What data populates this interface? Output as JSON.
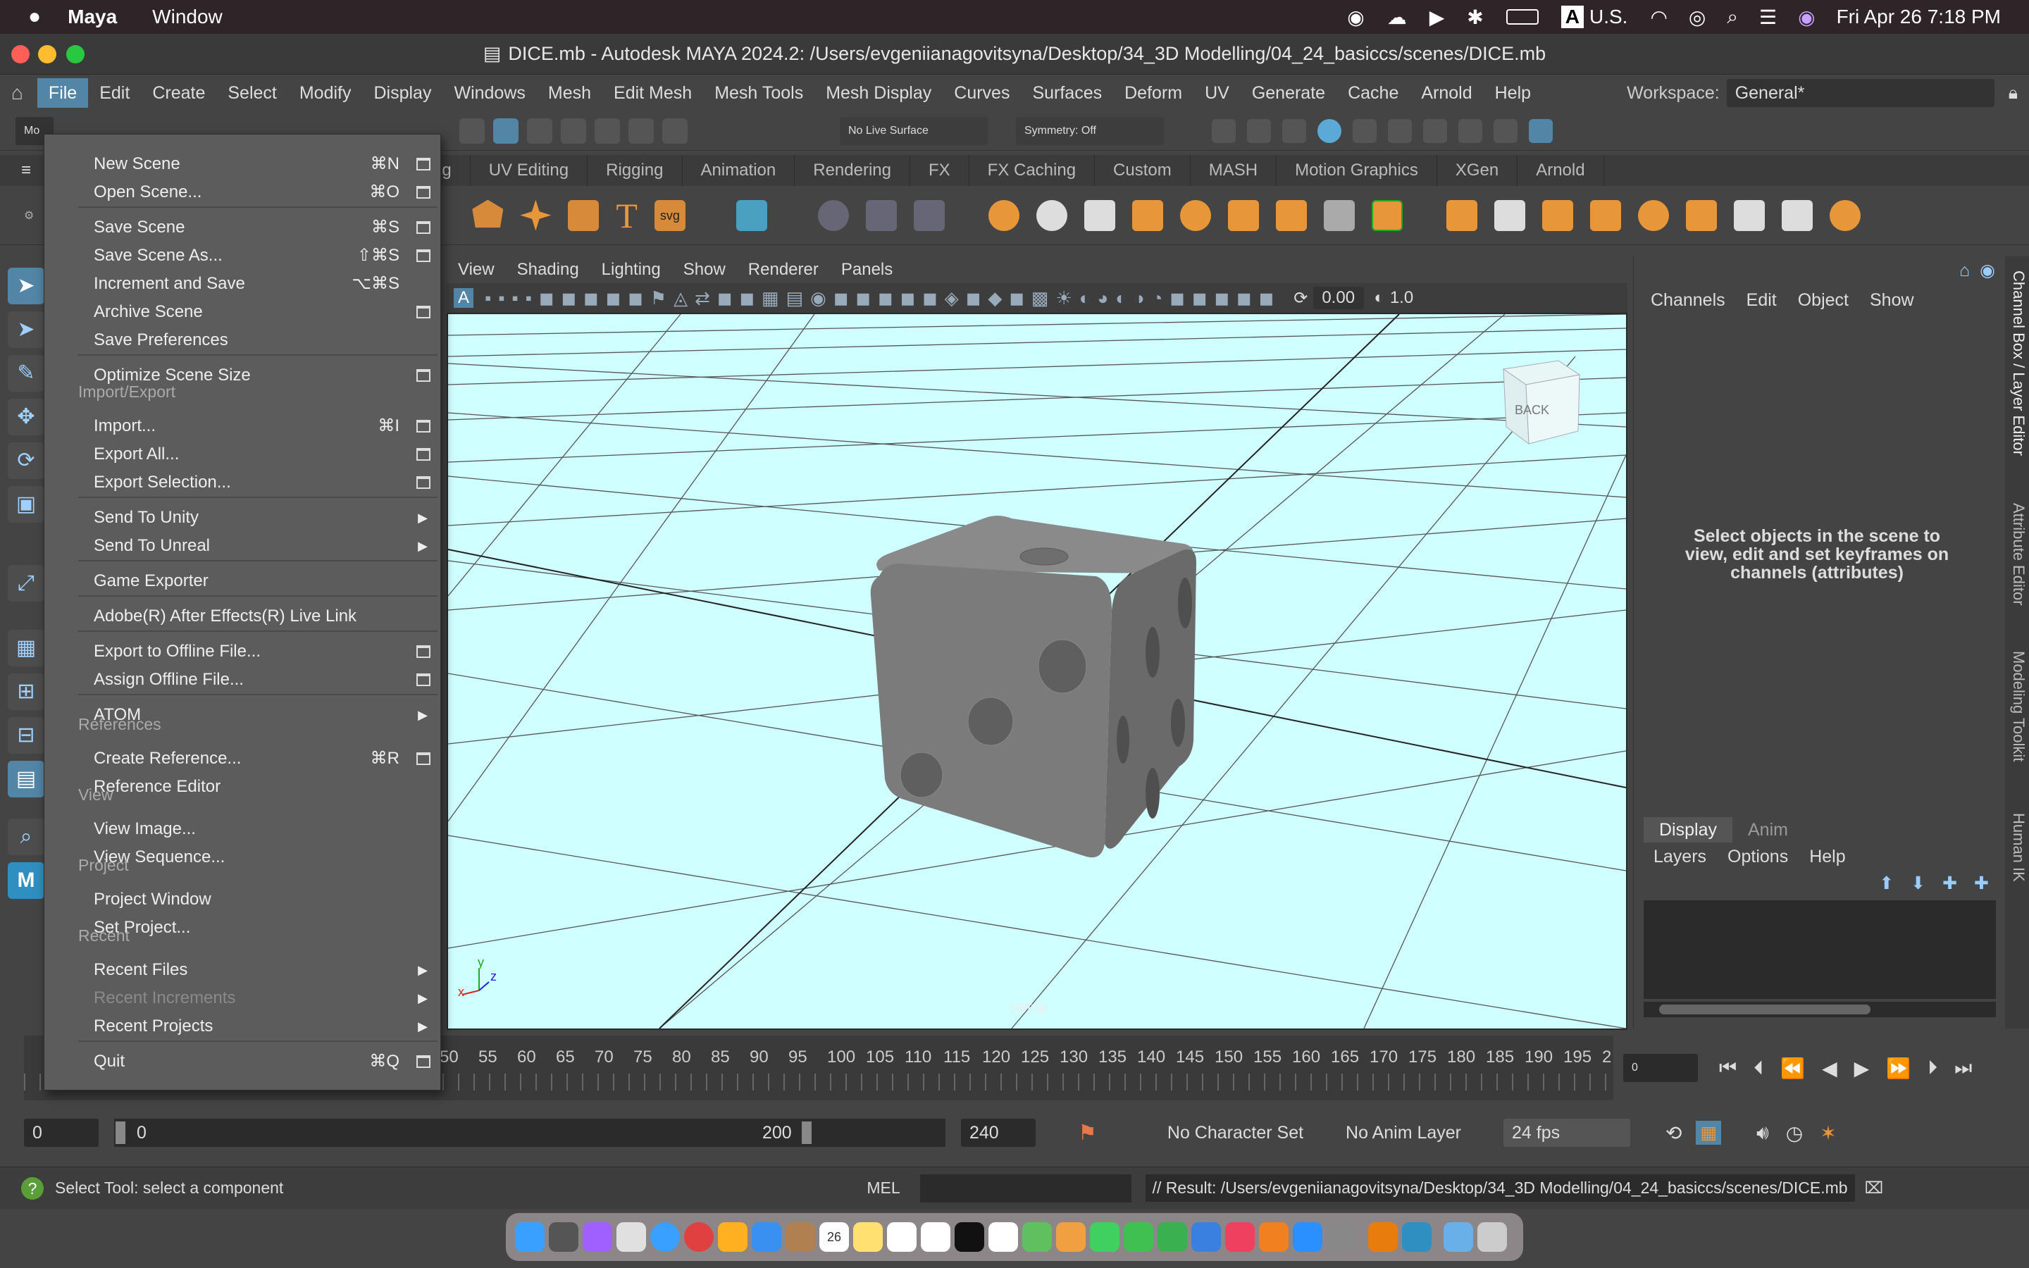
{
  "mac_menubar": {
    "app": "Maya",
    "items": [
      "Window"
    ],
    "input": "U.S.",
    "clock": "Fri Apr 26  7:18 PM"
  },
  "window": {
    "title": "DICE.mb - Autodesk MAYA 2024.2: /Users/evgeniianagovitsyna/Desktop/34_3D Modelling/04_24_basiccs/scenes/DICE.mb"
  },
  "menubar": {
    "items": [
      "File",
      "Edit",
      "Create",
      "Select",
      "Modify",
      "Display",
      "Windows",
      "Mesh",
      "Edit Mesh",
      "Mesh Tools",
      "Mesh Display",
      "Curves",
      "Surfaces",
      "Deform",
      "UV",
      "Generate",
      "Cache",
      "Arnold",
      "Help"
    ],
    "active": "File",
    "workspace_label": "Workspace:",
    "workspace_value": "General*"
  },
  "statusline": {
    "live_surface": "No Live Surface",
    "symmetry": "Symmetry: Off",
    "mode_truncated": "Mo"
  },
  "shelf_tabs": [
    "ng",
    "UV Editing",
    "Rigging",
    "Animation",
    "Rendering",
    "FX",
    "FX Caching",
    "Custom",
    "MASH",
    "Motion Graphics",
    "XGen",
    "Arnold"
  ],
  "viewport": {
    "menus": [
      "View",
      "Shading",
      "Lighting",
      "Show",
      "Renderer",
      "Panels"
    ],
    "value_a": "0.00",
    "value_b": "1.0",
    "camera": "persp",
    "viewcube": "BACK",
    "axis_x": "x",
    "axis_y": "y",
    "axis_z": "z"
  },
  "channel_box": {
    "menus": [
      "Channels",
      "Edit",
      "Object",
      "Show"
    ],
    "message": "Select objects in the scene to view, edit and set keyframes on channels (attributes)",
    "layer_tabs": [
      "Display",
      "Anim"
    ],
    "layer_menus": [
      "Layers",
      "Options",
      "Help"
    ]
  },
  "side_tabs": [
    "Channel Box / Layer Editor",
    "Attribute Editor",
    "Modeling Toolkit",
    "Human IK"
  ],
  "file_menu": {
    "items": [
      {
        "label": "New Scene",
        "shortcut": "⌘N",
        "box": true
      },
      {
        "label": "Open Scene...",
        "shortcut": "⌘O",
        "box": true
      },
      {
        "label": "Save Scene",
        "shortcut": "⌘S",
        "box": true
      },
      {
        "label": "Save Scene As...",
        "shortcut": "⇧⌘S",
        "box": true
      },
      {
        "label": "Increment and Save",
        "shortcut": "⌥⌘S",
        "box": false
      },
      {
        "label": "Archive Scene",
        "shortcut": "",
        "box": true
      },
      {
        "label": "Save Preferences",
        "shortcut": "",
        "box": false
      },
      {
        "label": "Optimize Scene Size",
        "shortcut": "",
        "box": true
      },
      {
        "label": "Import...",
        "shortcut": "⌘I",
        "box": true
      },
      {
        "label": "Export All...",
        "shortcut": "",
        "box": true
      },
      {
        "label": "Export Selection...",
        "shortcut": "",
        "box": true
      },
      {
        "label": "Send To Unity",
        "shortcut": "",
        "box": false,
        "sub": true
      },
      {
        "label": "Send To Unreal",
        "shortcut": "",
        "box": false,
        "sub": true
      },
      {
        "label": "Game Exporter",
        "shortcut": "",
        "box": false
      },
      {
        "label": "Adobe(R) After Effects(R) Live Link",
        "shortcut": "",
        "box": false
      },
      {
        "label": "Export to Offline File...",
        "shortcut": "",
        "box": true
      },
      {
        "label": "Assign Offline File...",
        "shortcut": "",
        "box": true
      },
      {
        "label": "ATOM",
        "shortcut": "",
        "box": false,
        "sub": true
      },
      {
        "label": "Create Reference...",
        "shortcut": "⌘R",
        "box": true
      },
      {
        "label": "Reference Editor",
        "shortcut": "",
        "box": false
      },
      {
        "label": "View Image...",
        "shortcut": "",
        "box": false
      },
      {
        "label": "View Sequence...",
        "shortcut": "",
        "box": false
      },
      {
        "label": "Project Window",
        "shortcut": "",
        "box": false
      },
      {
        "label": "Set Project...",
        "shortcut": "",
        "box": false
      },
      {
        "label": "Recent Files",
        "shortcut": "",
        "box": false,
        "sub": true
      },
      {
        "label": "Recent Increments",
        "shortcut": "",
        "box": false,
        "sub": true,
        "disabled": true
      },
      {
        "label": "Recent Projects",
        "shortcut": "",
        "box": false,
        "sub": true
      },
      {
        "label": "Quit",
        "shortcut": "⌘Q",
        "box": true
      }
    ],
    "sections": [
      "Import/Export",
      "References",
      "View",
      "Project",
      "Recent"
    ]
  },
  "timeline": {
    "ticks": [
      "50",
      "55",
      "60",
      "65",
      "70",
      "75",
      "80",
      "85",
      "90",
      "95",
      "100",
      "105",
      "110",
      "115",
      "120",
      "125",
      "130",
      "135",
      "140",
      "145",
      "150",
      "155",
      "160",
      "165",
      "170",
      "175",
      "180",
      "185",
      "190",
      "195",
      "2"
    ],
    "current_frame": "0"
  },
  "range": {
    "start": "0",
    "range_start": "0",
    "range_end": "200",
    "end": "240",
    "character_set": "No Character Set",
    "anim_layer": "No Anim Layer",
    "fps": "24 fps"
  },
  "helpline": {
    "text": "Select Tool: select a component",
    "mel": "MEL",
    "result": "// Result: /Users/evgeniianagovitsyna/Desktop/34_3D Modelling/04_24_basiccs/scenes/DICE.mb"
  },
  "colors": {
    "accent": "#5285a6",
    "viewport_bg": "#cfffff",
    "menu_bg": "#5c5c5c"
  }
}
